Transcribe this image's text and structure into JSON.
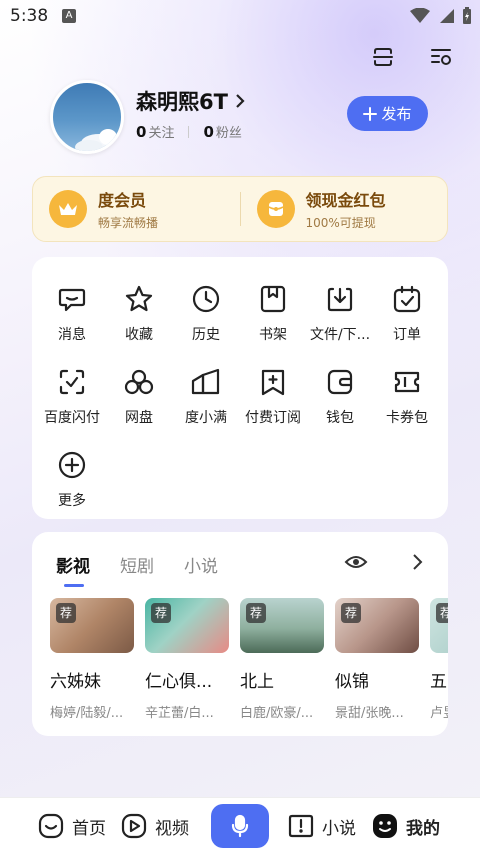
{
  "status_bar": {
    "time": "5:38",
    "notification_letter": "A"
  },
  "profile": {
    "username": "森明熙6T",
    "following_count": "0",
    "following_label": "关注",
    "followers_count": "0",
    "followers_label": "粉丝",
    "publish_label": "发布"
  },
  "promo": {
    "vip_title": "度会员",
    "vip_subtitle": "畅享流畅播",
    "redpacket_title": "领现金红包",
    "redpacket_subtitle": "100%可提现"
  },
  "grid": [
    {
      "label": "消息",
      "icon": "message-icon"
    },
    {
      "label": "收藏",
      "icon": "star-icon"
    },
    {
      "label": "历史",
      "icon": "clock-icon"
    },
    {
      "label": "书架",
      "icon": "bookmark-icon"
    },
    {
      "label": "文件/下...",
      "icon": "download-icon"
    },
    {
      "label": "订单",
      "icon": "calendar-check-icon"
    },
    {
      "label": "百度闪付",
      "icon": "scan-icon"
    },
    {
      "label": "网盘",
      "icon": "cloud-disk-icon"
    },
    {
      "label": "度小满",
      "icon": "duxiaoman-icon"
    },
    {
      "label": "付费订阅",
      "icon": "subscribe-icon"
    },
    {
      "label": "钱包",
      "icon": "wallet-icon"
    },
    {
      "label": "卡券包",
      "icon": "ticket-icon"
    },
    {
      "label": "更多",
      "icon": "plus-circle-icon"
    }
  ],
  "media": {
    "tabs": [
      "影视",
      "短剧",
      "小说"
    ],
    "active_tab": "影视",
    "tag": "荐",
    "posters": [
      {
        "title": "六姊妹",
        "cast": "梅婷/陆毅/...",
        "color_a": "#c9a48a",
        "color_b": "#8a6a55"
      },
      {
        "title": "仁心俱...",
        "cast": "辛芷蕾/白...",
        "color_a": "#4fb6a6",
        "color_b": "#e07a7a"
      },
      {
        "title": "北上",
        "cast": "白鹿/欧豪/...",
        "color_a": "#a7c7c2",
        "color_b": "#5f7f6d"
      },
      {
        "title": "似锦",
        "cast": "景甜/张晚...",
        "color_a": "#d9c7c0",
        "color_b": "#7e5a4e"
      },
      {
        "title": "五",
        "cast": "卢昱",
        "color_a": "#bcd8d4",
        "color_b": "#8fb4b0"
      }
    ]
  },
  "bottom_nav": {
    "home": "首页",
    "video": "视频",
    "novel": "小说",
    "mine": "我的"
  },
  "colors": {
    "accent": "#4e6ef2",
    "gold": "#f6b73c"
  }
}
